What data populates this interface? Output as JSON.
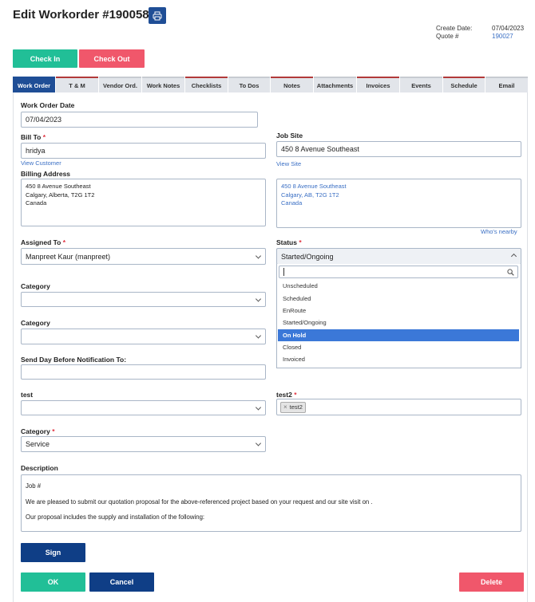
{
  "header": {
    "title": "Edit Workorder #190058",
    "create_date_label": "Create Date:",
    "create_date_value": "07/04/2023",
    "quote_label": "Quote #",
    "quote_value": "190027"
  },
  "actions": {
    "check_in": "Check In",
    "check_out": "Check Out"
  },
  "tabs": [
    {
      "label": "Work Order",
      "state": "active"
    },
    {
      "label": "T & M",
      "state": "marked"
    },
    {
      "label": "Vendor Ord.",
      "state": "plain"
    },
    {
      "label": "Work Notes",
      "state": "plain"
    },
    {
      "label": "Checklists",
      "state": "marked"
    },
    {
      "label": "To Dos",
      "state": "plain"
    },
    {
      "label": "Notes",
      "state": "marked"
    },
    {
      "label": "Attachments",
      "state": "plain"
    },
    {
      "label": "Invoices",
      "state": "marked"
    },
    {
      "label": "Events",
      "state": "plain"
    },
    {
      "label": "Schedule",
      "state": "marked"
    },
    {
      "label": "Email",
      "state": "plain"
    }
  ],
  "form": {
    "work_order_date_label": "Work Order Date",
    "work_order_date_value": "07/04/2023",
    "bill_to_label": "Bill To",
    "bill_to_value": "hridya",
    "view_customer": "View Customer",
    "job_site_label": "Job Site",
    "job_site_value": "450 8 Avenue Southeast",
    "view_site": "View Site",
    "billing_address_label": "Billing Address",
    "billing_address_lines": [
      "450 8 Avenue Southeast",
      "Calgary, Alberta, T2G 1T2",
      "Canada"
    ],
    "site_address_lines": [
      "450 8 Avenue Southeast",
      "Calgary, AB, T2G 1T2",
      "Canada"
    ],
    "whos_nearby": "Who's nearby",
    "assigned_to_label": "Assigned To",
    "assigned_to_value": "Manpreet Kaur (manpreet)",
    "status_label": "Status",
    "status_value": "Started/Ongoing",
    "category1_label": "Category",
    "category1_value": "",
    "category2_label": "Category",
    "category2_value": "",
    "send_day_label": "Send Day Before Notification To:",
    "send_day_value": "",
    "test_label": "test",
    "test_value": "",
    "test2_label": "test2",
    "test2_tag": "test2",
    "category3_label": "Category",
    "category3_value": "Service",
    "description_label": "Description",
    "description_lines": [
      "Job #",
      "We are pleased to submit our quotation proposal for the above-referenced project based on your request and our site visit on .",
      "Our proposal includes the supply and installation of the following:"
    ]
  },
  "status_dropdown": {
    "search_value": "",
    "options": [
      "Unscheduled",
      "Scheduled",
      "EnRoute",
      "Started/Ongoing",
      "On Hold",
      "Closed",
      "Invoiced"
    ],
    "highlighted": "On Hold"
  },
  "footer": {
    "sign": "Sign",
    "ok": "OK",
    "cancel": "Cancel",
    "delete": "Delete"
  }
}
